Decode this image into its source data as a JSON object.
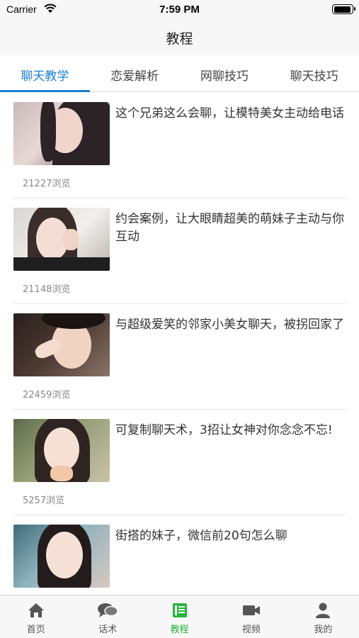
{
  "status_bar": {
    "carrier": "Carrier",
    "time": "7:59 PM"
  },
  "nav": {
    "title": "教程"
  },
  "tabs": [
    {
      "label": "聊天教学",
      "active": true
    },
    {
      "label": "恋爱解析",
      "active": false
    },
    {
      "label": "网聊技巧",
      "active": false
    },
    {
      "label": "聊天技巧",
      "active": false
    }
  ],
  "articles": [
    {
      "title": "这个兄弟这么会聊，让模特美女主动给电话",
      "views": "21227浏览"
    },
    {
      "title": "约会案例，让大眼睛超美的萌妹子主动与你互动",
      "views": "21148浏览"
    },
    {
      "title": "与超级爱笑的邻家小美女聊天，被拐回家了",
      "views": "22459浏览"
    },
    {
      "title": "可复制聊天术，3招让女神对你念念不忘!",
      "views": "5257浏览"
    },
    {
      "title": "街搭的妹子，微信前20句怎么聊",
      "views": ""
    }
  ],
  "tabbar": [
    {
      "label": "首页",
      "icon": "home-icon",
      "active": false
    },
    {
      "label": "话术",
      "icon": "chat-bubbles-icon",
      "active": false
    },
    {
      "label": "教程",
      "icon": "list-icon",
      "active": true
    },
    {
      "label": "视频",
      "icon": "video-camera-icon",
      "active": false
    },
    {
      "label": "我的",
      "icon": "person-icon",
      "active": false
    }
  ],
  "colors": {
    "accent": "#1a7fd6",
    "tab_active": "#27b43e"
  }
}
